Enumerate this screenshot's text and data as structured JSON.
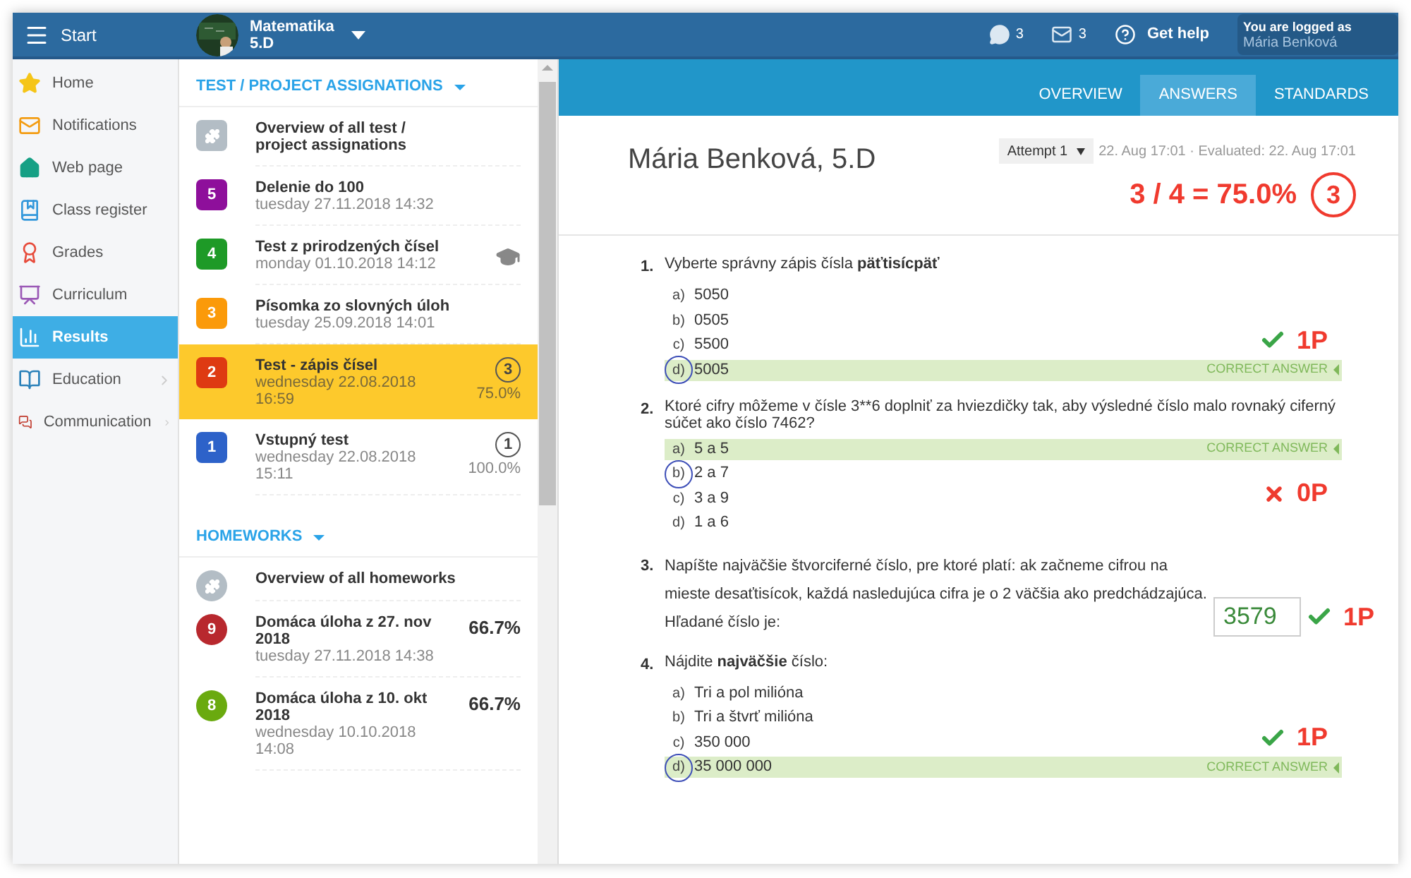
{
  "top_bar": {
    "start": "Start",
    "course": {
      "name": "Matematika",
      "class": "5.D"
    },
    "messages_count": "3",
    "mail_count": "3",
    "help": "Get help",
    "login": {
      "caption": "You are logged as",
      "user": "Mária Benková"
    }
  },
  "sidebar": {
    "items": [
      {
        "label": "Home",
        "selected": false,
        "expandable": false
      },
      {
        "label": "Notifications",
        "selected": false,
        "expandable": false
      },
      {
        "label": "Web page",
        "selected": false,
        "expandable": false
      },
      {
        "label": "Class register",
        "selected": false,
        "expandable": false
      },
      {
        "label": "Grades",
        "selected": false,
        "expandable": false
      },
      {
        "label": "Curriculum",
        "selected": false,
        "expandable": false
      },
      {
        "label": "Results",
        "selected": true,
        "expandable": false
      },
      {
        "label": "Education",
        "selected": false,
        "expandable": true
      },
      {
        "label": "Communication",
        "selected": false,
        "expandable": true
      }
    ]
  },
  "sections": [
    {
      "kind": "tests",
      "title": "TEST / PROJECT ASSIGNATIONS",
      "items": [
        {
          "kind": "overview",
          "title": "Overview of all test / project assignations",
          "selected": false
        },
        {
          "kind": "entry",
          "badge": "5",
          "color": "#8e0f9b",
          "title": "Delenie do 100",
          "date": "tuesday 27.11.2018 14:32",
          "cap_icon": false,
          "selected": false
        },
        {
          "kind": "entry",
          "badge": "4",
          "color": "#1e9a27",
          "title": "Test z prirodzených čísel",
          "date": "monday 01.10.2018 14:12",
          "cap_icon": true,
          "selected": false
        },
        {
          "kind": "entry",
          "badge": "3",
          "color": "#fb9a0a",
          "title": "Písomka zo slovných úloh",
          "date": "tuesday 25.09.2018 14:01",
          "cap_icon": false,
          "selected": false
        },
        {
          "kind": "entry",
          "badge": "2",
          "color": "#de3a12",
          "title": "Test - zápis čísel",
          "date": "wednesday 22.08.2018 16:59",
          "grade": "3",
          "percent": "75.0%",
          "cap_icon": false,
          "selected": true
        },
        {
          "kind": "entry",
          "badge": "1",
          "color": "#2d62c9",
          "title": "Vstupný test",
          "date": "wednesday 22.08.2018 15:11",
          "grade": "1",
          "percent": "100.0%",
          "cap_icon": false,
          "selected": false
        }
      ]
    },
    {
      "kind": "homeworks",
      "title": "HOMEWORKS",
      "items": [
        {
          "kind": "overview",
          "title": "Overview of all homeworks",
          "selected": false
        },
        {
          "kind": "entry",
          "badge": "9",
          "color": "#b8282e",
          "title": "Domáca úloha z 27. nov 2018",
          "date": "tuesday 27.11.2018 14:38",
          "percent": "66.7%",
          "cap_icon": false,
          "selected": false
        },
        {
          "kind": "entry",
          "badge": "8",
          "color": "#6aaa0f",
          "title": "Domáca úloha z 10. okt 2018",
          "date": "wednesday 10.10.2018 14:08",
          "percent": "66.7%",
          "cap_icon": false,
          "selected": false
        }
      ]
    }
  ],
  "tabs": [
    {
      "label": "OVERVIEW",
      "selected": false
    },
    {
      "label": "ANSWERS",
      "selected": true
    },
    {
      "label": "STANDARDS",
      "selected": false
    }
  ],
  "header": {
    "student": "Mária Benková, 5.D",
    "attempt": "Attempt 1",
    "times": "22. Aug 17:01 · Evaluated: 22. Aug 17:01",
    "score": "3 / 4 = 75.0%",
    "grade": "3"
  },
  "questions": [
    {
      "kind": "choice",
      "number": "1.",
      "text": "Vyberte správny zápis čísla **päťtisícpäť**",
      "correct": true,
      "points": "1P",
      "options": [
        {
          "letter": "a)",
          "text": "5050",
          "chosen": false,
          "correct": false
        },
        {
          "letter": "b)",
          "text": "0505",
          "chosen": false,
          "correct": false
        },
        {
          "letter": "c)",
          "text": "5500",
          "chosen": false,
          "correct": false
        },
        {
          "letter": "d)",
          "text": "5005",
          "chosen": true,
          "correct": true,
          "note": "CORRECT ANSWER"
        }
      ]
    },
    {
      "kind": "choice",
      "number": "2.",
      "text": "Ktoré cifry môžeme v čísle 3**6 doplniť za hviezdičky tak, aby výsledné číslo malo rovnaký ciferný súčet ako číslo 7462?",
      "correct": false,
      "points": "0P",
      "options": [
        {
          "letter": "a)",
          "text": "5 a 5",
          "chosen": false,
          "correct": true,
          "note": "CORRECT ANSWER"
        },
        {
          "letter": "b)",
          "text": "2 a 7",
          "chosen": true,
          "correct": false
        },
        {
          "letter": "c)",
          "text": "3 a 9",
          "chosen": false,
          "correct": false
        },
        {
          "letter": "d)",
          "text": "1 a 6",
          "chosen": false,
          "correct": false
        }
      ]
    },
    {
      "kind": "fill",
      "number": "3.",
      "text": "Napíšte najväčšie štvorciferné číslo, pre ktoré platí: ak začneme cifrou na mieste desaťtisícok, každá nasledujúca cifra je o 2 väčšia ako predchádzajúca. Hľadané číslo je:",
      "answer": "3579",
      "correct": true,
      "points": "1P"
    },
    {
      "kind": "choice",
      "number": "4.",
      "text": "Nájdite **najväčšie** číslo:",
      "correct": true,
      "points": "1P",
      "options": [
        {
          "letter": "a)",
          "text": "Tri a pol milióna",
          "chosen": false,
          "correct": false
        },
        {
          "letter": "b)",
          "text": "Tri a štvrť milióna",
          "chosen": false,
          "correct": false
        },
        {
          "letter": "c)",
          "text": "350 000",
          "chosen": false,
          "correct": false
        },
        {
          "letter": "d)",
          "text": "35 000 000",
          "chosen": true,
          "correct": true,
          "note": "CORRECT ANSWER"
        }
      ]
    }
  ]
}
